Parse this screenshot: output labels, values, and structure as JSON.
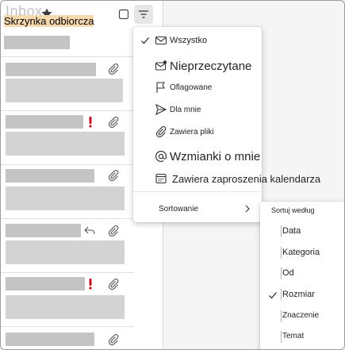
{
  "header": {
    "ghost_title": "Inbox",
    "inbox_label": "Skrzynka odbiorcza"
  },
  "filter_menu": {
    "items": [
      {
        "label": "Wszystko",
        "icon": "envelope-icon",
        "checked": true
      },
      {
        "label": "Nieprzeczytane",
        "icon": "envelope-dot-icon",
        "checked": false
      },
      {
        "label": "Oflagowane",
        "icon": "flag-icon",
        "checked": false
      },
      {
        "label": "Dla mnie",
        "icon": "send-icon",
        "checked": false
      },
      {
        "label": "Zawiera pliki",
        "icon": "paperclip-icon",
        "checked": false
      },
      {
        "label": "Wzmianki o mnie",
        "icon": "at-icon",
        "checked": false
      },
      {
        "label": "Zawiera zaproszenia kalendarza",
        "icon": "calendar-icon",
        "checked": false
      }
    ],
    "sort_label": "Sortowanie"
  },
  "sort_submenu": {
    "heading": "Sortuj według",
    "items": [
      {
        "label": "Data",
        "checked": false
      },
      {
        "label": "Kategoria",
        "checked": false
      },
      {
        "label": "Od",
        "checked": false
      },
      {
        "label": "Rozmiar",
        "checked": true
      },
      {
        "label": "Znaczenie",
        "checked": false
      },
      {
        "label": "Temat",
        "checked": false
      }
    ]
  },
  "colors": {
    "placeholder_block": "#c4c4c4",
    "important_flag": "#c50f1f",
    "menu_bg": "#ffffff"
  }
}
